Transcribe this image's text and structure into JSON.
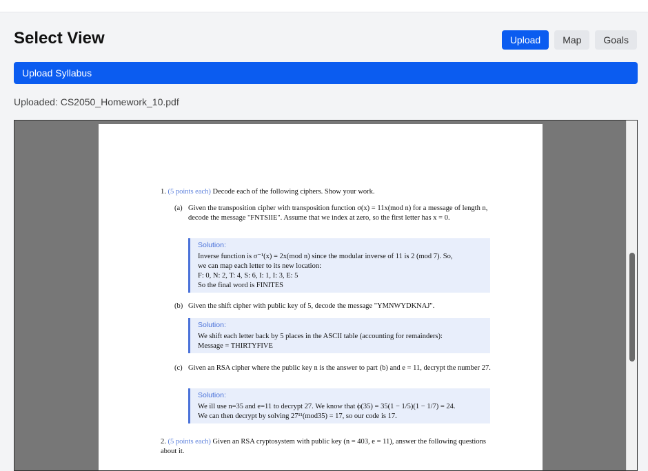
{
  "header": {
    "title": "Select View"
  },
  "view_buttons": {
    "upload": "Upload",
    "map": "Map",
    "goals": "Goals"
  },
  "upload_bar": {
    "label": "Upload Syllabus"
  },
  "uploaded_file": {
    "label": "Uploaded: CS2050_Homework_10.pdf"
  },
  "document": {
    "q1": {
      "number": "1.",
      "points": "(5 points each)",
      "text": "Decode each of the following ciphers. Show your work.",
      "a": {
        "label": "(a)",
        "text": "Given the transposition cipher with transposition function σ(x) = 11x(mod n) for a message of length n, decode the message \"FNTSIIE\". Assume that we index at zero, so the first letter has x = 0.",
        "solution_head": "Solution:",
        "solution_lines": [
          "Inverse function is σ⁻¹(x) = 2x(mod n) since the modular inverse of 11 is 2 (mod 7). So,",
          "we can map each letter to its new location:",
          "F: 0, N: 2, T: 4, S: 6, I: 1, I: 3, E: 5",
          "So the final word is FINITES"
        ]
      },
      "b": {
        "label": "(b)",
        "text": "Given the shift cipher with public key of 5, decode the message \"YMNWYDKNAJ\".",
        "solution_head": "Solution:",
        "solution_lines": [
          "We shift each letter back by 5 places in the ASCII table (accounting for remainders):",
          "Message = THIRTYFIVE"
        ]
      },
      "c": {
        "label": "(c)",
        "text": "Given an RSA cipher where the public key n is the answer to part (b) and e = 11, decrypt the number 27.",
        "solution_head": "Solution:",
        "solution_lines": [
          "We ill use n=35 and e=11 to decrypt 27. We know that ϕ(35) = 35(1 − 1/5)(1 − 1/7) = 24.",
          "We can then decrypt by solving 27¹¹(mod35) = 17, so our code is 17."
        ]
      }
    },
    "q2": {
      "number": "2.",
      "points": "(5 points each)",
      "text": "Given an RSA cryptosystem with public key (n = 403, e = 11), answer the following questions about it."
    }
  },
  "colors": {
    "primary": "#0b5cf0",
    "solution_accent": "#4a72d9",
    "solution_bg": "#e8eefb"
  }
}
